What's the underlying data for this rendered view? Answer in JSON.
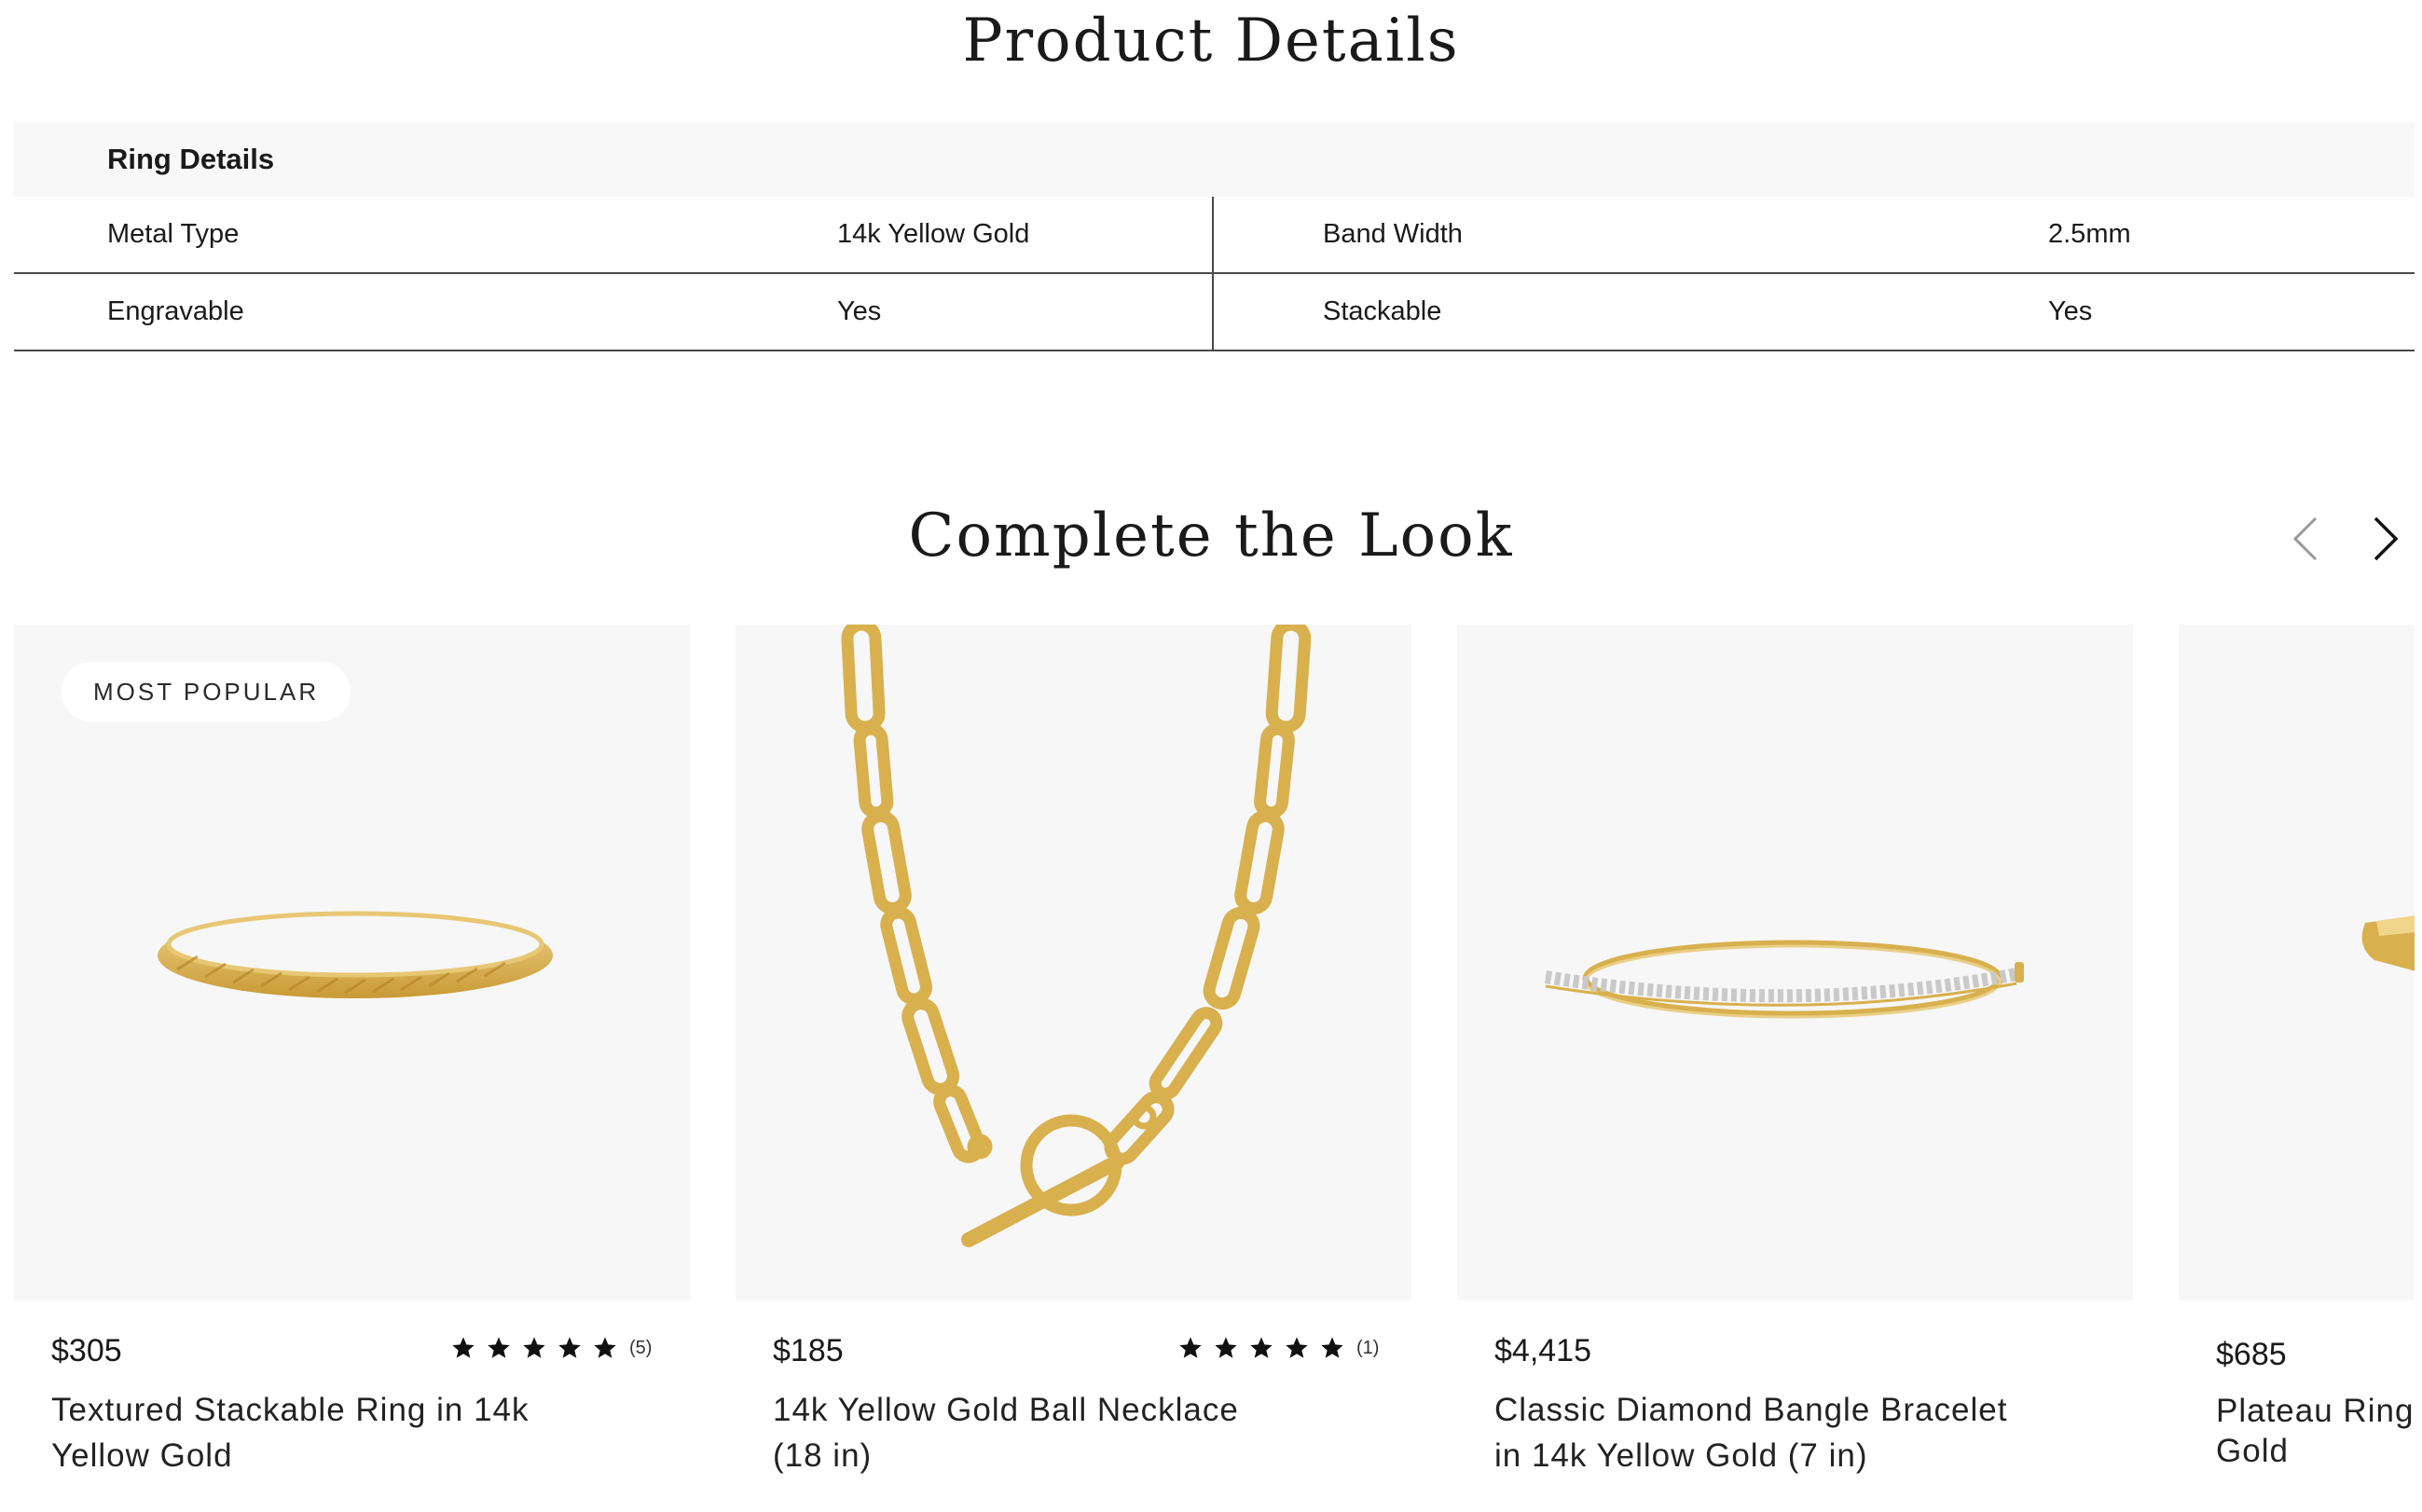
{
  "product_details": {
    "title": "Product Details",
    "section_heading": "Ring Details",
    "rows": [
      {
        "left_label": "Metal Type",
        "left_value": "14k Yellow Gold",
        "right_label": "Band Width",
        "right_value": "2.5mm"
      },
      {
        "left_label": "Engravable",
        "left_value": "Yes",
        "right_label": "Stackable",
        "right_value": "Yes"
      }
    ]
  },
  "complete_the_look": {
    "title": "Complete the Look",
    "products": [
      {
        "badge": "MOST POPULAR",
        "price": "$305",
        "rating": 5,
        "rating_count": "(5)",
        "name_line1": "Textured Stackable Ring in 14k",
        "name_line2": "Yellow Gold",
        "image": "textured-ring"
      },
      {
        "price": "$185",
        "rating": 5,
        "rating_count": "(1)",
        "name_line1": "14k Yellow Gold Ball Necklace",
        "name_line2": "(18 in)",
        "image": "paperclip-toggle-necklace"
      },
      {
        "price": "$4,415",
        "name_line1": "Classic Diamond Bangle Bracelet",
        "name_line2": "in 14k Yellow Gold (7 in)",
        "image": "diamond-bangle"
      },
      {
        "price": "$685",
        "name_line1": "Plateau Ring",
        "name_line2": "Gold",
        "image": "signet-ring"
      }
    ]
  },
  "colors": {
    "gold": "#d8b04e",
    "gold_dark": "#b8902e",
    "card_bg": "#f7f7f7",
    "text": "#1a1a1a"
  },
  "icons": {
    "prev": "chevron-left-icon",
    "next": "chevron-right-icon",
    "star": "star-icon"
  }
}
